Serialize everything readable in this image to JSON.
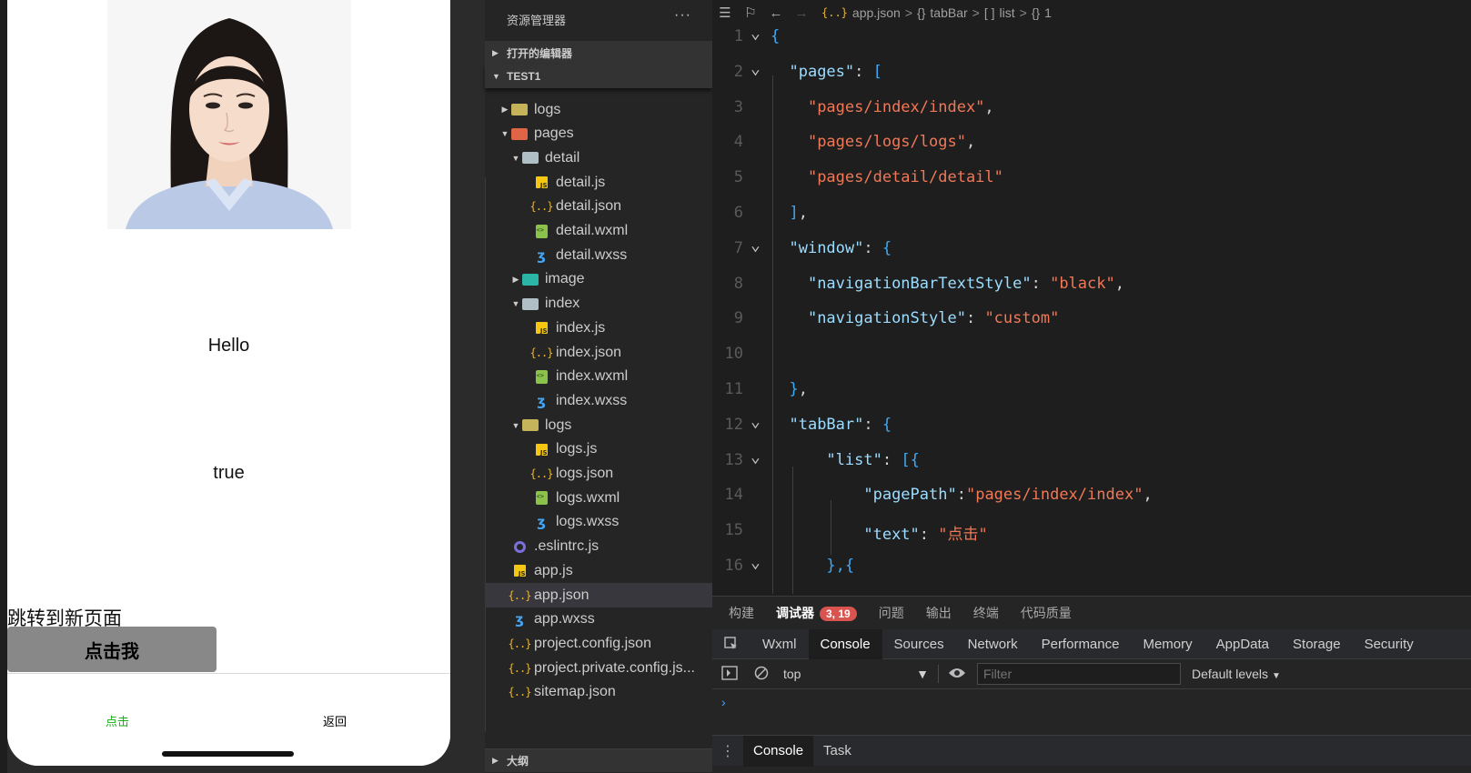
{
  "simulator": {
    "hello_text": "Hello",
    "bool_text": "true",
    "jump_text": "跳转到新页面",
    "button_label": "点击我",
    "tabbar": [
      {
        "label": "点击",
        "color": "#1aad19"
      },
      {
        "label": "返回",
        "color": "#000000"
      }
    ]
  },
  "explorer": {
    "title": "资源管理器",
    "more": "···",
    "open_editors": "打开的编辑器",
    "project": "TEST1",
    "outline": "大纲",
    "tree": [
      {
        "label": "logs",
        "icon": "folder-logs-icon",
        "depth": 1,
        "twisty": "▶"
      },
      {
        "label": "pages",
        "icon": "folder-pages-icon",
        "depth": 1,
        "twisty": "▼"
      },
      {
        "label": "detail",
        "icon": "folder-open-icon",
        "depth": 2,
        "twisty": "▼"
      },
      {
        "label": "detail.js",
        "icon": "js-file-icon",
        "depth": 3,
        "twisty": ""
      },
      {
        "label": "detail.json",
        "icon": "json-file-icon",
        "depth": 3,
        "twisty": ""
      },
      {
        "label": "detail.wxml",
        "icon": "wxml-file-icon",
        "depth": 3,
        "twisty": ""
      },
      {
        "label": "detail.wxss",
        "icon": "wxss-file-icon",
        "depth": 3,
        "twisty": ""
      },
      {
        "label": "image",
        "icon": "folder-image-icon",
        "depth": 2,
        "twisty": "▶"
      },
      {
        "label": "index",
        "icon": "folder-open-icon",
        "depth": 2,
        "twisty": "▼"
      },
      {
        "label": "index.js",
        "icon": "js-file-icon",
        "depth": 3,
        "twisty": ""
      },
      {
        "label": "index.json",
        "icon": "json-file-icon",
        "depth": 3,
        "twisty": ""
      },
      {
        "label": "index.wxml",
        "icon": "wxml-file-icon",
        "depth": 3,
        "twisty": ""
      },
      {
        "label": "index.wxss",
        "icon": "wxss-file-icon",
        "depth": 3,
        "twisty": ""
      },
      {
        "label": "logs",
        "icon": "folder-logs-icon",
        "depth": 2,
        "twisty": "▼"
      },
      {
        "label": "logs.js",
        "icon": "js-file-icon",
        "depth": 3,
        "twisty": ""
      },
      {
        "label": "logs.json",
        "icon": "json-file-icon",
        "depth": 3,
        "twisty": ""
      },
      {
        "label": "logs.wxml",
        "icon": "wxml-file-icon",
        "depth": 3,
        "twisty": ""
      },
      {
        "label": "logs.wxss",
        "icon": "wxss-file-icon",
        "depth": 3,
        "twisty": ""
      },
      {
        "label": ".eslintrc.js",
        "icon": "eslint-file-icon",
        "depth": 1,
        "twisty": ""
      },
      {
        "label": "app.js",
        "icon": "js-file-icon",
        "depth": 1,
        "twisty": ""
      },
      {
        "label": "app.json",
        "icon": "json-file-icon",
        "depth": 1,
        "twisty": "",
        "selected": true
      },
      {
        "label": "app.wxss",
        "icon": "wxss-file-icon",
        "depth": 1,
        "twisty": ""
      },
      {
        "label": "project.config.json",
        "icon": "json-file-icon",
        "depth": 1,
        "twisty": ""
      },
      {
        "label": "project.private.config.js...",
        "icon": "json-file-icon",
        "depth": 1,
        "twisty": ""
      },
      {
        "label": "sitemap.json",
        "icon": "json-file-icon",
        "depth": 1,
        "twisty": ""
      }
    ]
  },
  "breadcrumb": {
    "file": "app.json",
    "seg1_icon": "{}",
    "seg1": "tabBar",
    "seg2_icon": "[ ]",
    "seg2": "list",
    "seg3_icon": "{}",
    "seg3": "1",
    "separator": ">"
  },
  "code": {
    "line_numbers": [
      "1",
      "2",
      "3",
      "4",
      "5",
      "6",
      "7",
      "8",
      "9",
      "10",
      "11",
      "12",
      "13",
      "14",
      "15",
      "16"
    ],
    "lines": [
      [
        {
          "t": "{",
          "c": "br"
        }
      ],
      [
        {
          "t": "  "
        },
        {
          "t": "\"pages\"",
          "c": "k"
        },
        {
          "t": ": ",
          "c": "p"
        },
        {
          "t": "[",
          "c": "br"
        }
      ],
      [
        {
          "t": "    "
        },
        {
          "t": "\"pages/index/index\"",
          "c": "s"
        },
        {
          "t": ",",
          "c": "p"
        }
      ],
      [
        {
          "t": "    "
        },
        {
          "t": "\"pages/logs/logs\"",
          "c": "s"
        },
        {
          "t": ",",
          "c": "p"
        }
      ],
      [
        {
          "t": "    "
        },
        {
          "t": "\"pages/detail/detail\"",
          "c": "s"
        }
      ],
      [
        {
          "t": "  "
        },
        {
          "t": "]",
          "c": "br"
        },
        {
          "t": ",",
          "c": "p"
        }
      ],
      [
        {
          "t": "  "
        },
        {
          "t": "\"window\"",
          "c": "k"
        },
        {
          "t": ": ",
          "c": "p"
        },
        {
          "t": "{",
          "c": "br"
        }
      ],
      [
        {
          "t": "    "
        },
        {
          "t": "\"navigationBarTextStyle\"",
          "c": "k"
        },
        {
          "t": ": ",
          "c": "p"
        },
        {
          "t": "\"black\"",
          "c": "s"
        },
        {
          "t": ",",
          "c": "p"
        }
      ],
      [
        {
          "t": "    "
        },
        {
          "t": "\"navigationStyle\"",
          "c": "k"
        },
        {
          "t": ": ",
          "c": "p"
        },
        {
          "t": "\"custom\"",
          "c": "s"
        }
      ],
      [],
      [
        {
          "t": "  "
        },
        {
          "t": "}",
          "c": "br"
        },
        {
          "t": ",",
          "c": "p"
        }
      ],
      [
        {
          "t": "  "
        },
        {
          "t": "\"tabBar\"",
          "c": "k"
        },
        {
          "t": ": ",
          "c": "p"
        },
        {
          "t": "{",
          "c": "br"
        }
      ],
      [
        {
          "t": "      "
        },
        {
          "t": "\"list\"",
          "c": "k"
        },
        {
          "t": ": ",
          "c": "p"
        },
        {
          "t": "[{",
          "c": "br"
        }
      ],
      [
        {
          "t": "          "
        },
        {
          "t": "\"pagePath\"",
          "c": "k"
        },
        {
          "t": ":",
          "c": "p"
        },
        {
          "t": "\"pages/index/index\"",
          "c": "s"
        },
        {
          "t": ",",
          "c": "p"
        }
      ],
      [
        {
          "t": "          "
        },
        {
          "t": "\"text\"",
          "c": "k"
        },
        {
          "t": ": ",
          "c": "p"
        },
        {
          "t": "\"点击\"",
          "c": "s"
        }
      ],
      [
        {
          "t": "      "
        },
        {
          "t": "},{",
          "c": "br"
        }
      ]
    ],
    "fold_lines": [
      1,
      2,
      7,
      12,
      13,
      16
    ]
  },
  "panel": {
    "tabs": [
      "构建",
      "调试器",
      "问题",
      "输出",
      "终端",
      "代码质量"
    ],
    "active_tab": "调试器",
    "badge": "3, 19",
    "devtools_tabs": [
      "Wxml",
      "Console",
      "Sources",
      "Network",
      "Performance",
      "Memory",
      "AppData",
      "Storage",
      "Security"
    ],
    "devtools_active": "Console",
    "context": "top",
    "filter_placeholder": "Filter",
    "levels": "Default levels",
    "prompt": "›",
    "drawer_tabs": [
      "Console",
      "Task"
    ],
    "drawer_active": "Console"
  },
  "colors": {
    "tab_active": "#1aad19",
    "string": "#f07857",
    "key": "#9cdcfe",
    "bracket": "#3fa9f5",
    "badge": "#d9534f"
  }
}
